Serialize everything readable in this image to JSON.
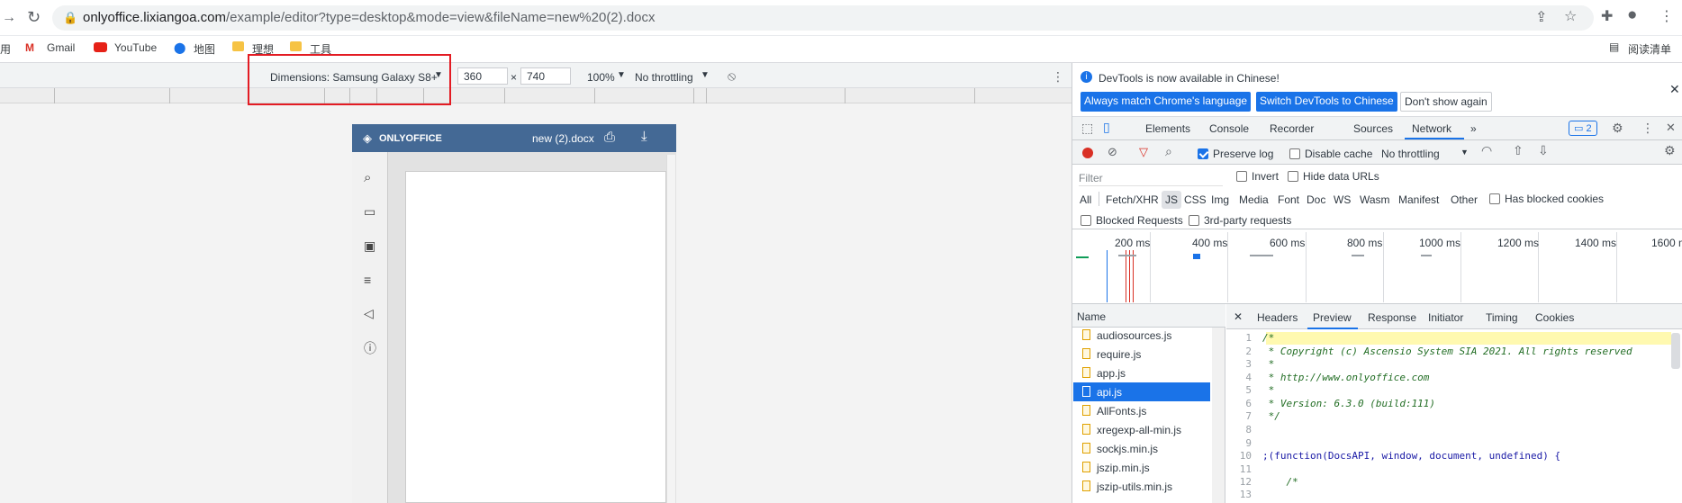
{
  "browser": {
    "url_host": "onlyoffice.lixiangoa.com",
    "url_path": "/example/editor?type=desktop&mode=view&fileName=new%20(2).docx",
    "bookmarks": [
      "用",
      "Gmail",
      "YouTube",
      "地图",
      "理想",
      "工具"
    ],
    "reading_list": "阅读清单"
  },
  "device_toolbar": {
    "dimensions_label": "Dimensions: Samsung Galaxy S8+",
    "width": "360",
    "height": "740",
    "times": "×",
    "zoom": "100%",
    "throttling": "No throttling"
  },
  "onlyoffice": {
    "logo": "ONLYOFFICE",
    "doc_title": "new (2).docx"
  },
  "devtools": {
    "info_message": "DevTools is now available in Chinese!",
    "btn_match": "Always match Chrome's language",
    "btn_switch": "Switch DevTools to Chinese",
    "btn_dont_show": "Don't show again",
    "tabs": [
      "Elements",
      "Console",
      "Recorder",
      "Sources",
      "Network"
    ],
    "issues_count": "2",
    "preserve_log": "Preserve log",
    "disable_cache": "Disable cache",
    "throttling": "No throttling",
    "filter_placeholder": "Filter",
    "invert": "Invert",
    "hide_data_urls": "Hide data URLs",
    "type_filters": [
      "All",
      "Fetch/XHR",
      "JS",
      "CSS",
      "Img",
      "Media",
      "Font",
      "Doc",
      "WS",
      "Wasm",
      "Manifest",
      "Other"
    ],
    "has_blocked_cookies": "Has blocked cookies",
    "blocked_requests": "Blocked Requests",
    "third_party": "3rd-party requests",
    "timeline_labels": [
      "200 ms",
      "400 ms",
      "600 ms",
      "800 ms",
      "1000 ms",
      "1200 ms",
      "1400 ms",
      "1600 m"
    ],
    "name_header": "Name",
    "requests": [
      "audiosources.js",
      "require.js",
      "app.js",
      "api.js",
      "AllFonts.js",
      "xregexp-all-min.js",
      "sockjs.min.js",
      "jszip.min.js",
      "jszip-utils.min.js"
    ],
    "detail_tabs": [
      "Headers",
      "Preview",
      "Response",
      "Initiator",
      "Timing",
      "Cookies"
    ],
    "code_lines": [
      {
        "n": "1",
        "t": "/*"
      },
      {
        "n": "2",
        "t": " * Copyright (c) Ascensio System SIA 2021. All rights reserved"
      },
      {
        "n": "3",
        "t": " *"
      },
      {
        "n": "4",
        "t": " * http://www.onlyoffice.com"
      },
      {
        "n": "5",
        "t": " *"
      },
      {
        "n": "6",
        "t": " * Version: 6.3.0 (build:111)"
      },
      {
        "n": "7",
        "t": " */"
      },
      {
        "n": "8",
        "t": ""
      },
      {
        "n": "9",
        "t": ""
      },
      {
        "n": "10",
        "t": ";(function(DocsAPI, window, document, undefined) {"
      },
      {
        "n": "11",
        "t": ""
      },
      {
        "n": "12",
        "t": "    /*"
      },
      {
        "n": "13",
        "t": ""
      }
    ]
  }
}
